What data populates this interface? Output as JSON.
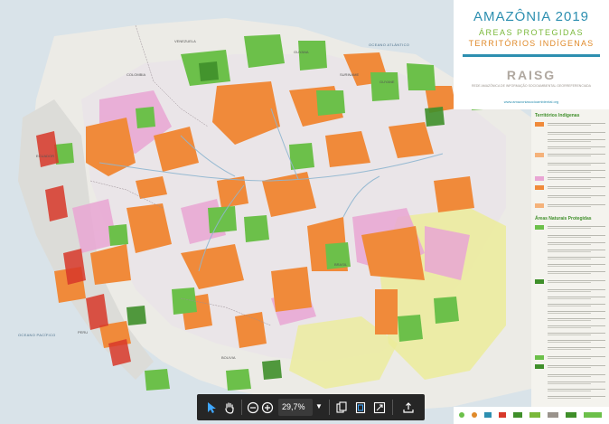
{
  "document": {
    "title": "AMAZÔNIA 2019",
    "subtitle_1": "ÁREAS PROTEGIDAS",
    "subtitle_2": "TERRITÓRIOS INDÍGENAS",
    "org_name": "RAISG",
    "org_tagline": "REDE AMAZÔNICA DE INFORMAÇÃO SOCIOAMBIENTAL GEORREFERENCIADA",
    "website": "www.amazoniasocioambiental.org"
  },
  "map_labels": {
    "ocean_atlantic": "OCEANO ATLÁNTICO",
    "ocean_pacific": "OCEANO PACÍFICO",
    "venezuela": "VENEZUELA",
    "colombia": "COLOMBIA",
    "guyana": "GUYANA",
    "suriname": "SURINAME",
    "guyane": "GUYANE",
    "ecuador": "ECUADOR",
    "peru": "PERU",
    "brasil": "BRASIL",
    "bolivia": "BOLIVIA"
  },
  "legend": {
    "section_indigenous": "Territórios Indígenas",
    "section_protected": "Áreas Naturais Protegidas"
  },
  "toolbar": {
    "zoom_value": "29,7%"
  },
  "colors": {
    "indigenous_orange": "#f08a3a",
    "protected_green": "#6cc04a",
    "pink_reserve": "#e9a6d4",
    "yellow_buffer": "#ecec9a",
    "toolbar_bg": "#262626",
    "title_teal": "#2d8fb0",
    "subtitle_green": "#7ab83a",
    "subtitle_orange": "#e08a2a"
  }
}
